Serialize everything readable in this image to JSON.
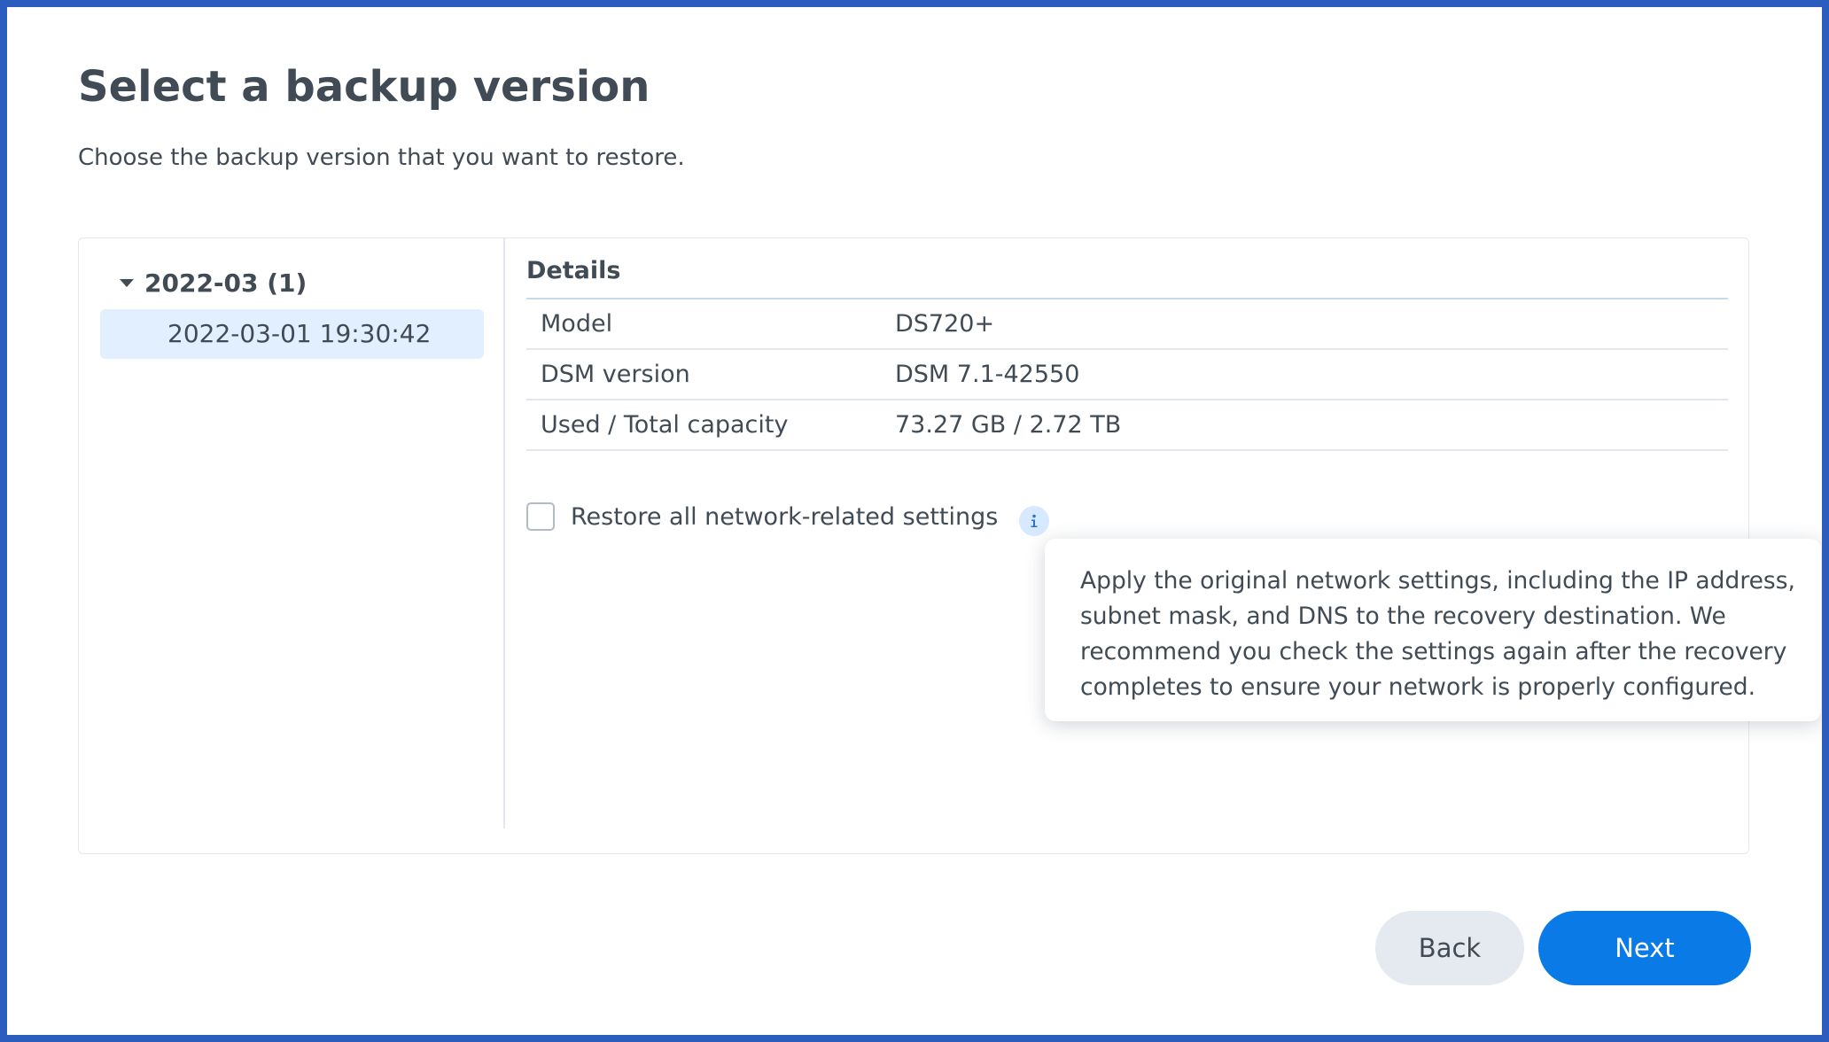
{
  "page": {
    "title": "Select a backup version",
    "subtitle": "Choose the backup version that you want to restore."
  },
  "tree": {
    "group_label": "2022-03 (1)",
    "items": [
      {
        "label": "2022-03-01 19:30:42",
        "selected": true
      }
    ]
  },
  "details": {
    "header": "Details",
    "rows": [
      {
        "key": "Model",
        "value": "DS720+"
      },
      {
        "key": "DSM version",
        "value": "DSM 7.1-42550"
      },
      {
        "key": "Used / Total capacity",
        "value": "73.27 GB / 2.72 TB"
      }
    ]
  },
  "option": {
    "label": "Restore all network-related settings",
    "checked": false,
    "icon": "info-icon"
  },
  "tooltip": {
    "text": "Apply the original network settings, including the IP address, subnet mask, and DNS to the recovery destination. We recommend you check the settings again after the recovery completes to ensure your network is properly configured."
  },
  "buttons": {
    "back": "Back",
    "next": "Next"
  },
  "colors": {
    "frame_border": "#2a5dbd",
    "accent": "#0a7ae6",
    "selected_item_bg": "#e2efff",
    "text": "#414b55"
  }
}
